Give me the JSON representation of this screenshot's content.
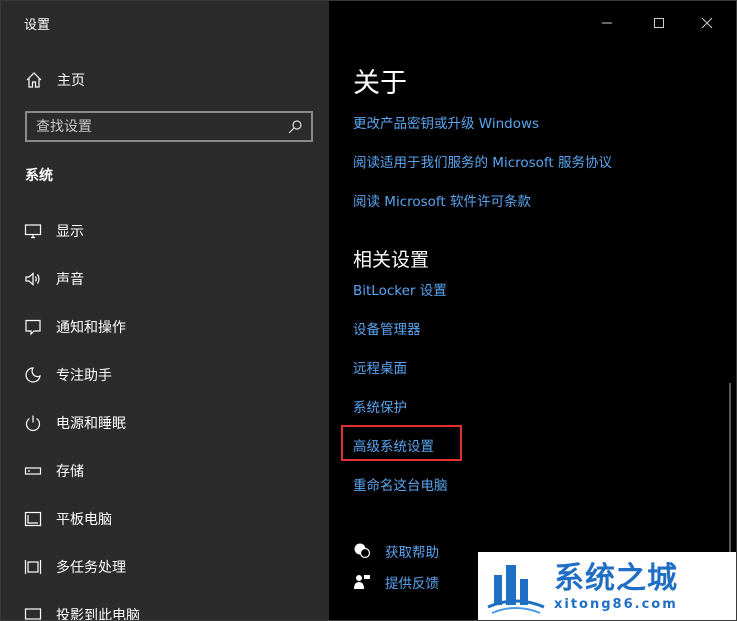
{
  "window": {
    "title": "设置"
  },
  "sidebar": {
    "home_label": "主页",
    "search": {
      "placeholder": "查找设置",
      "value": ""
    },
    "section_label": "系统",
    "items": [
      {
        "label": "显示",
        "icon": "monitor-icon"
      },
      {
        "label": "声音",
        "icon": "speaker-icon"
      },
      {
        "label": "通知和操作",
        "icon": "notification-icon"
      },
      {
        "label": "专注助手",
        "icon": "moon-icon"
      },
      {
        "label": "电源和睡眠",
        "icon": "power-icon"
      },
      {
        "label": "存储",
        "icon": "storage-icon"
      },
      {
        "label": "平板电脑",
        "icon": "tablet-icon"
      },
      {
        "label": "多任务处理",
        "icon": "multitask-icon"
      },
      {
        "label": "投影到此电脑",
        "icon": "project-icon"
      }
    ]
  },
  "main": {
    "about_heading": "关于",
    "about_links": [
      "更改产品密钥或升级 Windows",
      "阅读适用于我们服务的 Microsoft 服务协议",
      "阅读 Microsoft 软件许可条款"
    ],
    "related_heading": "相关设置",
    "related_links": [
      "BitLocker 设置",
      "设备管理器",
      "远程桌面",
      "系统保护",
      "高级系统设置",
      "重命名这台电脑"
    ],
    "help": {
      "get_help": "获取帮助",
      "feedback": "提供反馈"
    }
  },
  "watermark": {
    "cn": "系统之城",
    "en": "xitong86.com"
  },
  "colors": {
    "link": "#5aa5f0",
    "sidebar_bg": "#2b2b2b",
    "main_bg": "#000000",
    "highlight": "#e03030",
    "brand": "#1f6fc4"
  }
}
